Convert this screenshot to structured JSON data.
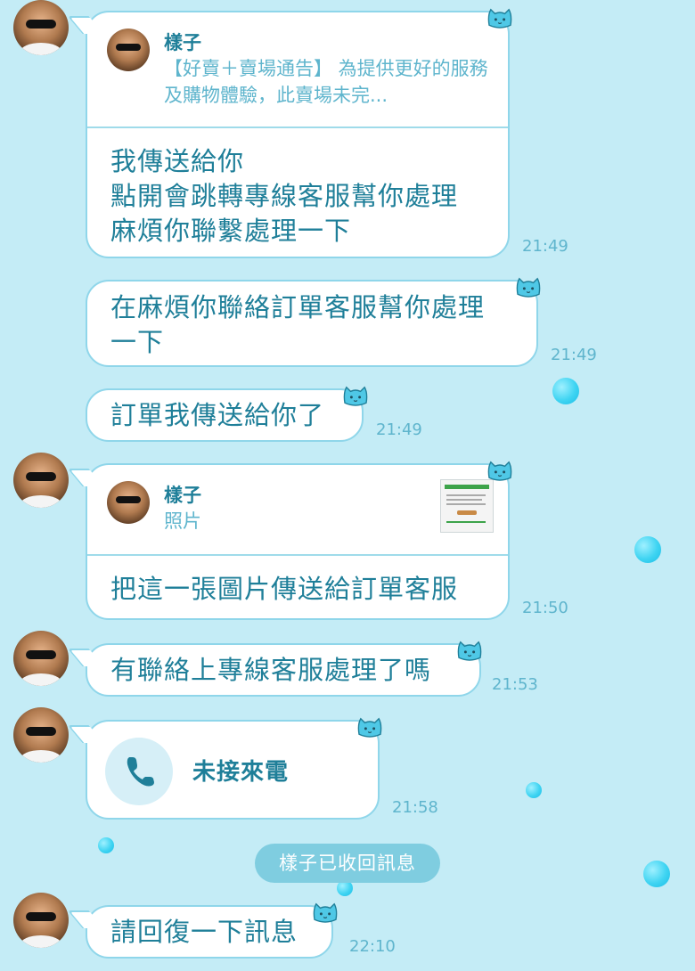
{
  "colors": {
    "background": "#c4ecf6",
    "bubble_border": "#8fd6ea",
    "text": "#1f7f99",
    "time": "#5fb5cd",
    "system_pill": "#7fcde0"
  },
  "messages": [
    {
      "reply": {
        "name": "樣子",
        "preview": "【好賣＋賣場通告】 為提供更好的服務及購物體驗，此賣場未完..."
      },
      "text": "我傳送給你\n點開會跳轉專線客服幫你處理\n麻煩你聯繫處理一下",
      "time": "21:49"
    },
    {
      "text": "在麻煩你聯絡訂單客服幫你處理\n一下",
      "time": "21:49"
    },
    {
      "text": "訂單我傳送給你了",
      "time": "21:49"
    },
    {
      "reply": {
        "name": "樣子",
        "preview": "照片"
      },
      "text": "把這一張圖片傳送給訂單客服",
      "time": "21:50"
    },
    {
      "text": "有聯絡上專線客服處理了嗎",
      "time": "21:53"
    },
    {
      "call_label": "未接來電",
      "call_icon": "phone-icon",
      "time": "21:58"
    },
    {
      "text": "請回復一下訊息",
      "time": "22:10"
    }
  ],
  "system_notice": "樣子已收回訊息",
  "sticker_icon": "cat-face-icon"
}
